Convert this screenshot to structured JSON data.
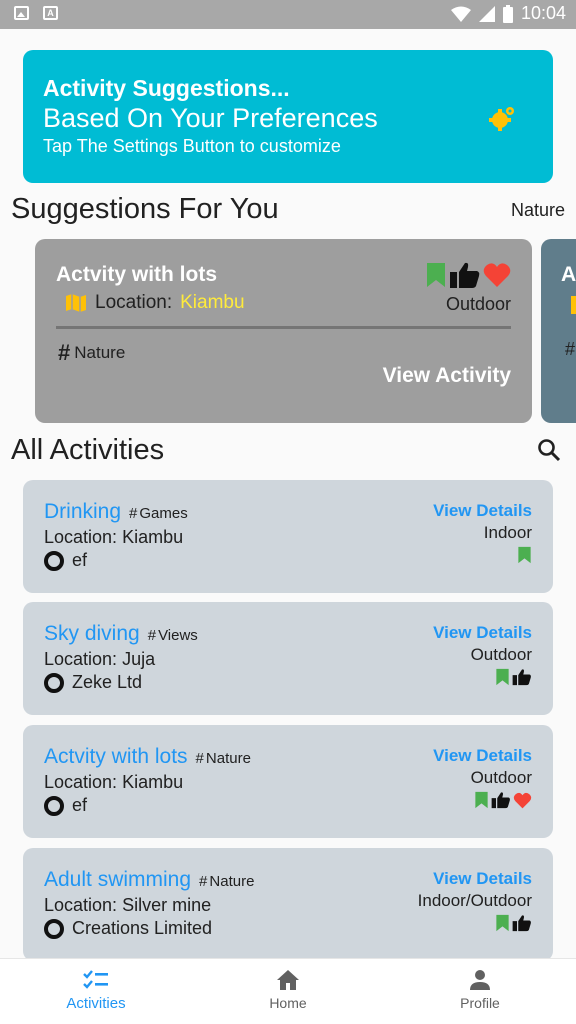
{
  "status_bar": {
    "time": "10:04"
  },
  "banner": {
    "title": "Activity Suggestions...",
    "subtitle": "Based On Your Preferences",
    "hint": "Tap The Settings Button to customize",
    "icon": "settings-gear-icon"
  },
  "suggestions": {
    "title": "Suggestions For You",
    "filter": "Nature",
    "card": {
      "title": "Actvity with lots",
      "location_label": "Location:",
      "location_value": "Kiambu",
      "type": "Outdoor",
      "tag": "Nature",
      "view_label": "View Activity",
      "icons": [
        "bookmark-icon",
        "thumbs-up-icon",
        "heart-icon"
      ]
    },
    "peek_card": {
      "initial": "A"
    }
  },
  "all_activities": {
    "title": "All Activities",
    "details_label": "View Details",
    "items": [
      {
        "name": "Drinking",
        "tag": "Games",
        "location_label": "Location:",
        "location": "Kiambu",
        "org": "ef",
        "type": "Indoor",
        "icons": [
          "bookmark-icon"
        ]
      },
      {
        "name": "Sky diving",
        "tag": "Views",
        "location_label": "Location:",
        "location": "Juja",
        "org": "Zeke Ltd",
        "type": "Outdoor",
        "icons": [
          "bookmark-icon",
          "thumbs-up-icon"
        ]
      },
      {
        "name": "Actvity with lots",
        "tag": "Nature",
        "location_label": "Location:",
        "location": "Kiambu",
        "org": "ef",
        "type": "Outdoor",
        "icons": [
          "bookmark-icon",
          "thumbs-up-icon",
          "heart-icon"
        ]
      },
      {
        "name": "Adult swimming",
        "tag": "Nature",
        "location_label": "Location:",
        "location": "Silver mine",
        "org": "Creations Limited",
        "type": "Indoor/Outdoor",
        "icons": [
          "bookmark-icon",
          "thumbs-up-icon"
        ]
      }
    ]
  },
  "bottom_nav": {
    "items": [
      {
        "label": "Activities",
        "icon": "checklist-icon",
        "active": true
      },
      {
        "label": "Home",
        "icon": "home-icon",
        "active": false
      },
      {
        "label": "Profile",
        "icon": "person-icon",
        "active": false
      }
    ]
  },
  "colors": {
    "accent": "#2196f3",
    "banner": "#00bcd4",
    "bookmark": "#4caf50",
    "heart": "#f44336",
    "gear": "#ffc107"
  }
}
